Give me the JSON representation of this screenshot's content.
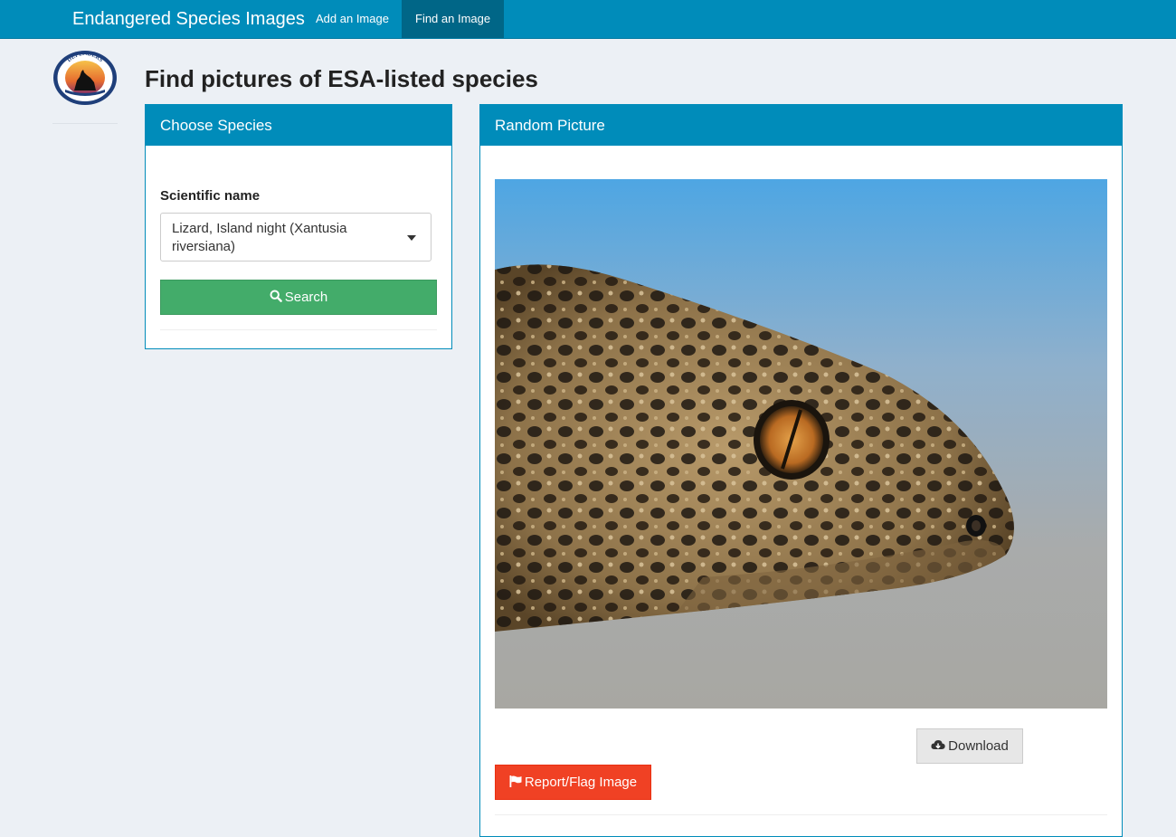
{
  "navbar": {
    "brand": "Endangered Species Images",
    "items": [
      {
        "label": "Add an Image"
      },
      {
        "label": "Find an Image",
        "active": true
      }
    ],
    "background": "#008cba",
    "active_background": "#006687"
  },
  "logo": {
    "icon": "defenders-of-wildlife-logo-icon",
    "text": "DEFENDERS OF WILDLIFE"
  },
  "page": {
    "title": "Find pictures of ESA-listed species"
  },
  "choose_species": {
    "heading": "Choose Species",
    "field_label": "Scientific name",
    "selected_value": "Lizard, Island night (Xantusia riversiana)",
    "search_button": "Search",
    "search_icon": "search-icon",
    "button_color": "#43ac6a"
  },
  "random_picture": {
    "heading": "Random Picture",
    "image_subject": "lizard-head-photo",
    "download_button": "Download",
    "download_icon": "cloud-download-icon",
    "report_button": "Report/Flag Image",
    "report_icon": "flag-icon",
    "report_color": "#f04124"
  }
}
